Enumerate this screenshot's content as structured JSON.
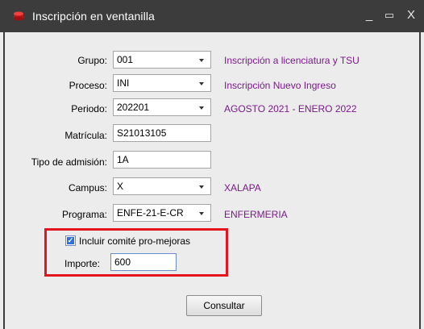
{
  "window": {
    "title": "Inscripción en ventanilla",
    "controls": {
      "minimize": "_",
      "maximize": "▭",
      "close": "X"
    },
    "icon": "app-icon-red"
  },
  "form": {
    "grupo": {
      "label": "Grupo:",
      "value": "001",
      "description": "Inscripción a licenciatura y TSU"
    },
    "proceso": {
      "label": "Proceso:",
      "value": "INI",
      "description": "Inscripción Nuevo Ingreso"
    },
    "periodo": {
      "label": "Periodo:",
      "value": "202201",
      "description": "AGOSTO 2021 - ENERO 2022"
    },
    "matricula": {
      "label": "Matrícula:",
      "value": "S21013105"
    },
    "tipo_admision": {
      "label": "Tipo de admisión:",
      "value": "1A"
    },
    "campus": {
      "label": "Campus:",
      "value": "X",
      "description": "XALAPA"
    },
    "programa": {
      "label": "Programa:",
      "value": "ENFE-21-E-CR",
      "description": "ENFERMERIA"
    },
    "incluir_comite": {
      "label": "Incluir comité pro-mejoras",
      "checked": true
    },
    "importe": {
      "label": "Importe:",
      "value": "600"
    }
  },
  "buttons": {
    "consultar": "Consultar"
  },
  "colors": {
    "titlebar": "#3c3c3c",
    "description_text": "#7a1a8a",
    "highlight": "#e3161f",
    "checkbox": "#2f6fd8"
  }
}
